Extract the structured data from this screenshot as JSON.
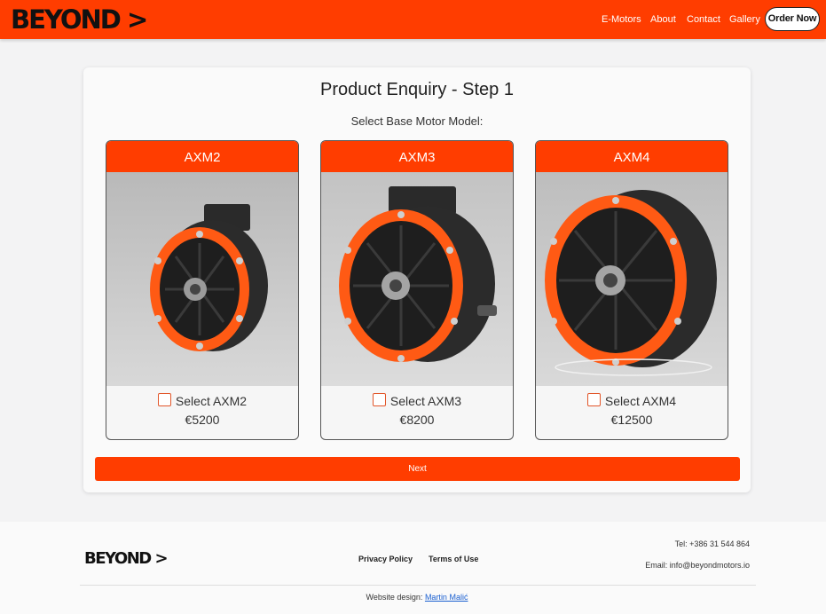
{
  "header": {
    "logo": "BEYOND >",
    "nav": [
      "E-Motors",
      "About",
      "Contact",
      "Gallery"
    ],
    "order_button": "Order Now",
    "brand_color": "#ff3d00"
  },
  "main": {
    "title": "Product Enquiry - Step 1",
    "subtitle": "Select Base Motor Model:",
    "models": [
      {
        "name": "AXM2",
        "select_label": "Select AXM2",
        "price": "€5200",
        "checked": false
      },
      {
        "name": "AXM3",
        "select_label": "Select AXM3",
        "price": "€8200",
        "checked": false
      },
      {
        "name": "AXM4",
        "select_label": "Select AXM4",
        "price": "€12500",
        "checked": false
      }
    ],
    "next_button": "Next"
  },
  "footer": {
    "logo": "BEYOND >",
    "links": [
      "Privacy Policy",
      "Terms of Use"
    ],
    "tel": "Tel: +386 31 544 864",
    "email": "Email: info@beyondmotors.io",
    "credit_prefix": "Website design:",
    "credit_name": "Martin Malić"
  }
}
